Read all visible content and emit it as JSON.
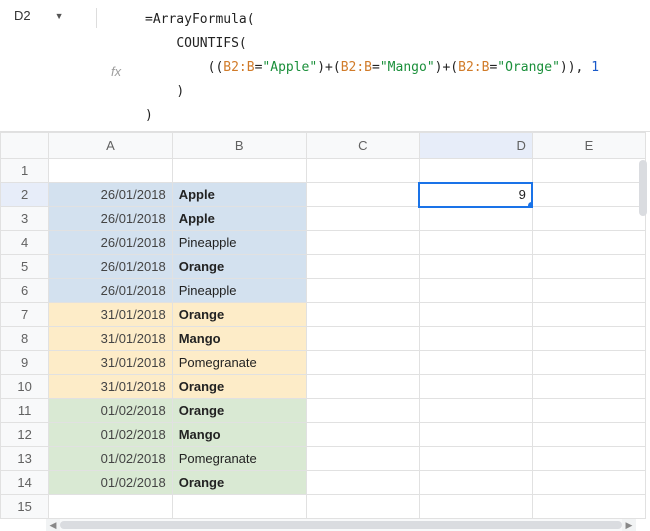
{
  "cell_ref": "D2",
  "fx_label": "fx",
  "formula_lines": {
    "l1_fn": "=ArrayFormula(",
    "l2_fn": "COUNTIFS(",
    "l3": {
      "open": "((",
      "rng": "B2:B",
      "eq": "=",
      "q": "\"",
      "s1": "Apple",
      "close1": ")+(",
      "s2": "Mango",
      "close2": ")+(",
      "s3": "Orange",
      "close3": ")), ",
      "num": "1"
    },
    "l4": ")",
    "l5": ")"
  },
  "columns": [
    "A",
    "B",
    "C",
    "D",
    "E"
  ],
  "active_col": "D",
  "active_row": 2,
  "active_value": "9",
  "rows": [
    {
      "n": 1
    },
    {
      "n": 2,
      "a": "26/01/2018",
      "b": "Apple",
      "bold": true,
      "bg": "blue"
    },
    {
      "n": 3,
      "a": "26/01/2018",
      "b": "Apple",
      "bold": true,
      "bg": "blue"
    },
    {
      "n": 4,
      "a": "26/01/2018",
      "b": "Pineapple",
      "bold": false,
      "bg": "blue"
    },
    {
      "n": 5,
      "a": "26/01/2018",
      "b": "Orange",
      "bold": true,
      "bg": "blue"
    },
    {
      "n": 6,
      "a": "26/01/2018",
      "b": "Pineapple",
      "bold": false,
      "bg": "blue"
    },
    {
      "n": 7,
      "a": "31/01/2018",
      "b": "Orange",
      "bold": true,
      "bg": "yellow"
    },
    {
      "n": 8,
      "a": "31/01/2018",
      "b": "Mango",
      "bold": true,
      "bg": "yellow"
    },
    {
      "n": 9,
      "a": "31/01/2018",
      "b": "Pomegranate",
      "bold": false,
      "bg": "yellow"
    },
    {
      "n": 10,
      "a": "31/01/2018",
      "b": "Orange",
      "bold": true,
      "bg": "yellow"
    },
    {
      "n": 11,
      "a": "01/02/2018",
      "b": "Orange",
      "bold": true,
      "bg": "green"
    },
    {
      "n": 12,
      "a": "01/02/2018",
      "b": "Mango",
      "bold": true,
      "bg": "green"
    },
    {
      "n": 13,
      "a": "01/02/2018",
      "b": "Pomegranate",
      "bold": false,
      "bg": "green"
    },
    {
      "n": 14,
      "a": "01/02/2018",
      "b": "Orange",
      "bold": true,
      "bg": "green"
    },
    {
      "n": 15
    }
  ]
}
